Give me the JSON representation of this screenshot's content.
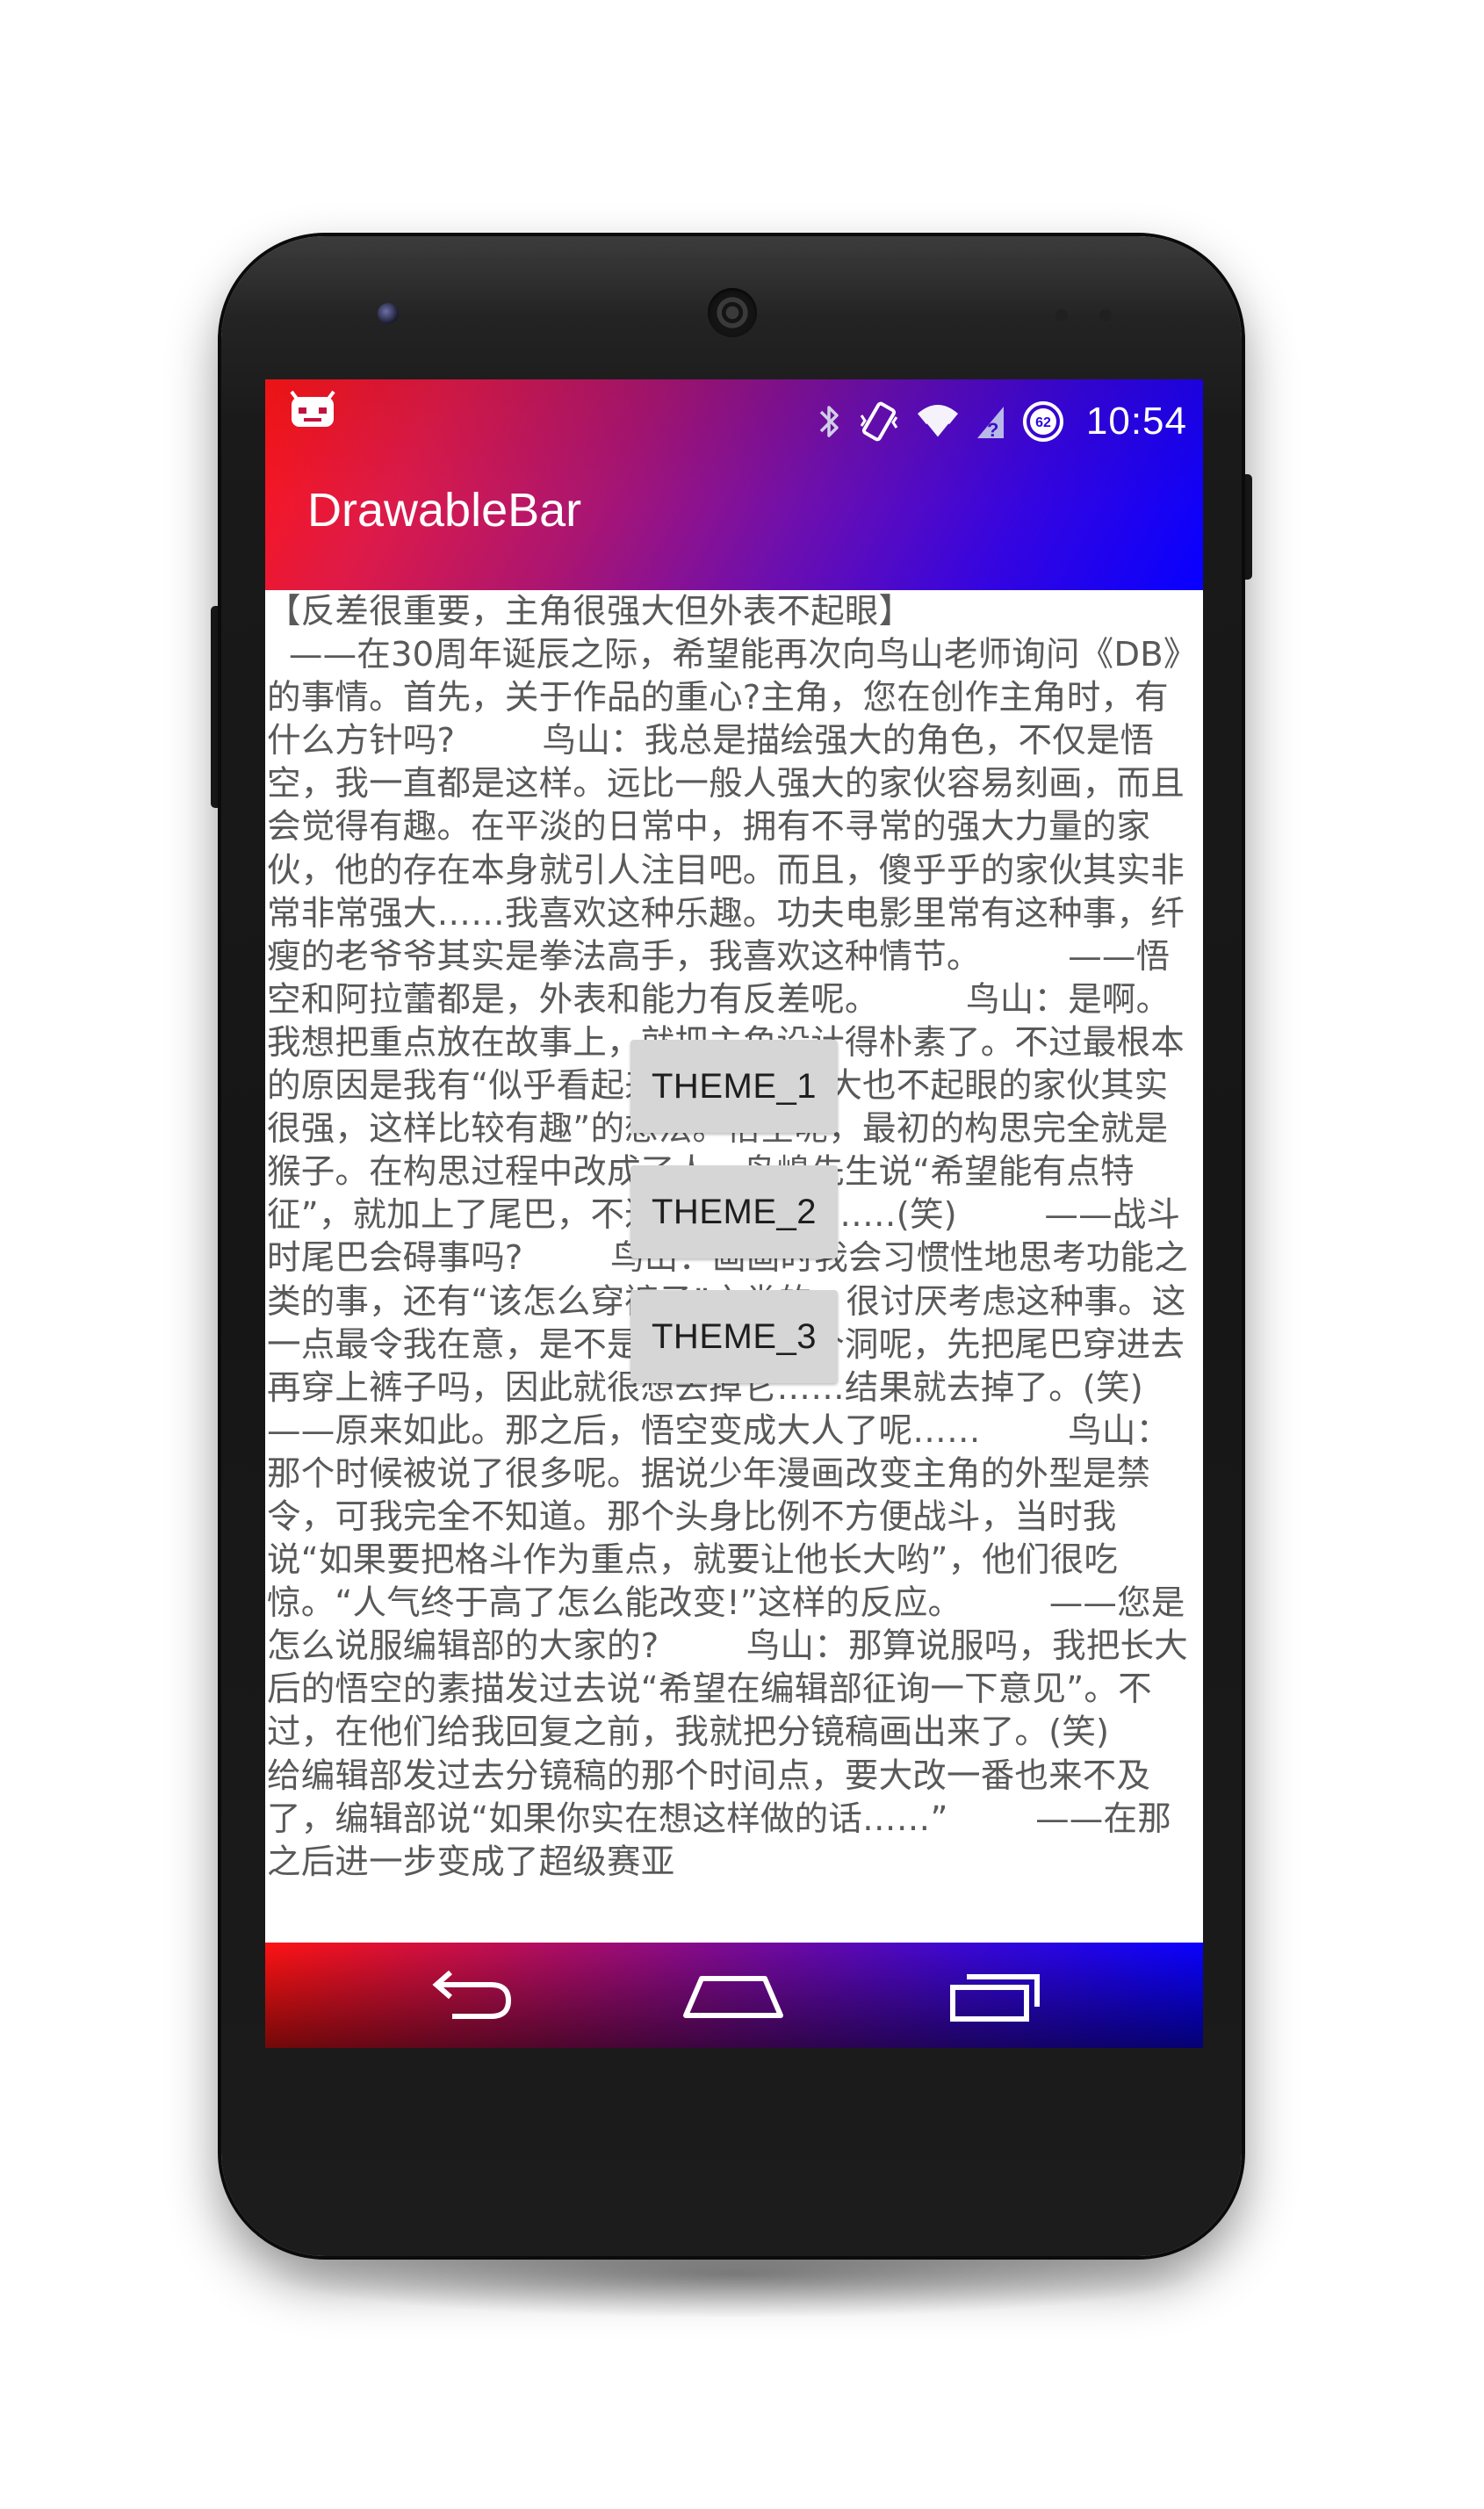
{
  "status_bar": {
    "time": "10:54",
    "battery_level": "62",
    "icons": [
      "cyanogenmod-icon",
      "bluetooth-icon",
      "vibrate-icon",
      "wifi-icon",
      "signal-icon",
      "battery-icon"
    ]
  },
  "app_bar": {
    "title": "DrawableBar"
  },
  "article": {
    "text": "【反差很重要，主角很强大但外表不起眼】\n  ——在30周年诞辰之际，希望能再次向鸟山老师询问《DB》的事情。首先，关于作品的重心?主角，您在创作主角时，有什么方针吗?        鸟山：我总是描绘强大的角色，不仅是悟空，我一直都是这样。远比一般人强大的家伙容易刻画，而且会觉得有趣。在平淡的日常中，拥有不寻常的强大力量的家伙，他的存在本身就引人注目吧。而且，傻乎乎的家伙其实非常非常强大……我喜欢这种乐趣。功夫电影里常有这种事，纤瘦的老爷爷其实是拳法高手，我喜欢这种情节。        ——悟空和阿拉蕾都是，外表和能力有反差呢。        鸟山：是啊。我想把重点放在故事上，就把主角设计得朴素了。不过最根本的原因是我有“似乎看起来一点都不强大也不起眼的家伙其实很强，这样比较有趣”的想法。悟空呢，最初的构思完全就是猴子。在构思过程中改成了人，鸟嶋先生说“希望能有点特征”，就加上了尾巴，不过总是碍事呢……(笑)        ——战斗时尾巴会碍事吗?        鸟山：画画时我会习惯性地思考功能之类的事，还有“该怎么穿裤子”之类的，很讨厌考虑这种事。这一点最令我在意，是不是裤子上要留个洞呢，先把尾巴穿进去再穿上裤子吗，因此就很想去掉它……结果就去掉了。(笑)        ——原来如此。那之后，悟空变成大人了呢……        鸟山：那个时候被说了很多呢。据说少年漫画改变主角的外型是禁令，可我完全不知道。那个头身比例不方便战斗，当时我说“如果要把格斗作为重点，就要让他长大哟”，他们很吃惊。“人气终于高了怎么能改变!”这样的反应。        ——您是怎么说服编辑部的大家的?        鸟山：那算说服吗，我把长大后的悟空的素描发过去说“希望在编辑部征询一下意见”。不过，在他们给我回复之前，我就把分镜稿画出来了。(笑)        给编辑部发过去分镜稿的那个时间点，要大改一番也来不及了，编辑部说“如果你实在想这样做的话……”        ——在那之后进一步变成了超级赛亚"
  },
  "buttons": {
    "theme_1": "THEME_1",
    "theme_2": "THEME_2",
    "theme_3": "THEME_3"
  },
  "nav_bar": {
    "icons": [
      "back-icon",
      "home-icon",
      "recents-icon"
    ]
  },
  "colors": {
    "gradient_start": "#ff1515",
    "gradient_end": "#0700ff",
    "text": "#595959",
    "button_bg": "#d6d6d6"
  }
}
